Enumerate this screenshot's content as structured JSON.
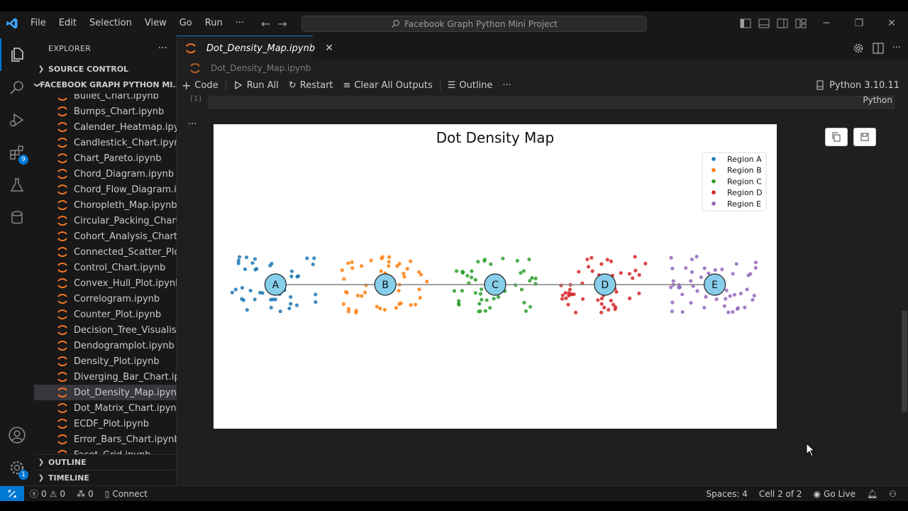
{
  "menu": {
    "items": [
      "File",
      "Edit",
      "Selection",
      "View",
      "Go",
      "Run",
      "···"
    ]
  },
  "search": {
    "text": "Facebook Graph Python Mini Project"
  },
  "sidebar": {
    "title": "EXPLORER",
    "more": "···",
    "source_control": "SOURCE CONTROL",
    "folder": "FACEBOOK GRAPH PYTHON MI...",
    "files": [
      "Bullet_Chart.ipynb",
      "Bumps_Chart.ipynb",
      "Calender_Heatmap.ipynb",
      "Candlestick_Chart.ipynb",
      "Chart_Pareto.ipynb",
      "Chord_Diagram.ipynb",
      "Chord_Flow_Diagram.ip...",
      "Choropleth_Map.ipynb",
      "Circular_Packing_Chart.i...",
      "Cohort_Analysis_Chart.i...",
      "Connected_Scatter_Plot...",
      "Control_Chart.ipynb",
      "Convex_Hull_Plot.ipynb",
      "Correlogram.ipynb",
      "Counter_Plot.ipynb",
      "Decision_Tree_Visualisa...",
      "Dendogramplot.ipynb",
      "Density_Plot.ipynb",
      "Diverging_Bar_Chart.ip...",
      "Dot_Density_Map.ipynb",
      "Dot_Matrix_Chart.ipynb",
      "ECDF_Plot.ipynb",
      "Error_Bars_Chart.ipynb",
      "Facet_Grid.ipynb"
    ],
    "selected_index": 19,
    "outline": "OUTLINE",
    "timeline": "TIMELINE"
  },
  "activity": {
    "extensions_badge": "9",
    "settings_badge": "1"
  },
  "editor": {
    "tab_label": "Dot_Density_Map.ipynb",
    "tab_close": "✕",
    "breadcrumb": "Dot_Density_Map.ipynb",
    "toolbar": {
      "code": "Code",
      "run_all": "Run All",
      "restart": "Restart",
      "clear_all": "Clear All Outputs",
      "outline": "Outline",
      "more": "···",
      "kernel": "Python 3.10.11"
    },
    "cell": {
      "exec_count": "[1]",
      "language": "Python",
      "output_more": "···"
    }
  },
  "chart_data": {
    "type": "scatter",
    "title": "Dot Density Map",
    "nodes": [
      {
        "label": "A",
        "x": 1,
        "y": 0
      },
      {
        "label": "B",
        "x": 2,
        "y": 0
      },
      {
        "label": "C",
        "x": 3,
        "y": 0
      },
      {
        "label": "D",
        "x": 4,
        "y": 0
      },
      {
        "label": "E",
        "x": 5,
        "y": 0
      }
    ],
    "edges": [
      [
        "A",
        "B"
      ],
      [
        "B",
        "C"
      ],
      [
        "C",
        "D"
      ],
      [
        "D",
        "E"
      ]
    ],
    "node_color": "#87ceeb",
    "series": [
      {
        "name": "Region A",
        "color": "#1f77b4",
        "center": "A",
        "count": 50
      },
      {
        "name": "Region B",
        "color": "#ff7f0e",
        "center": "B",
        "count": 50
      },
      {
        "name": "Region C",
        "color": "#2ca02c",
        "center": "C",
        "count": 50
      },
      {
        "name": "Region D",
        "color": "#d62728",
        "center": "D",
        "count": 50
      },
      {
        "name": "Region E",
        "color": "#9467bd",
        "center": "E",
        "count": 50
      }
    ],
    "legend": "top-right",
    "grid": false
  },
  "status": {
    "errors": "0",
    "warnings": "0",
    "ports": "0",
    "connect": "Connect",
    "spaces": "Spaces: 4",
    "cell": "Cell 2 of 2",
    "golive": "Go Live"
  }
}
